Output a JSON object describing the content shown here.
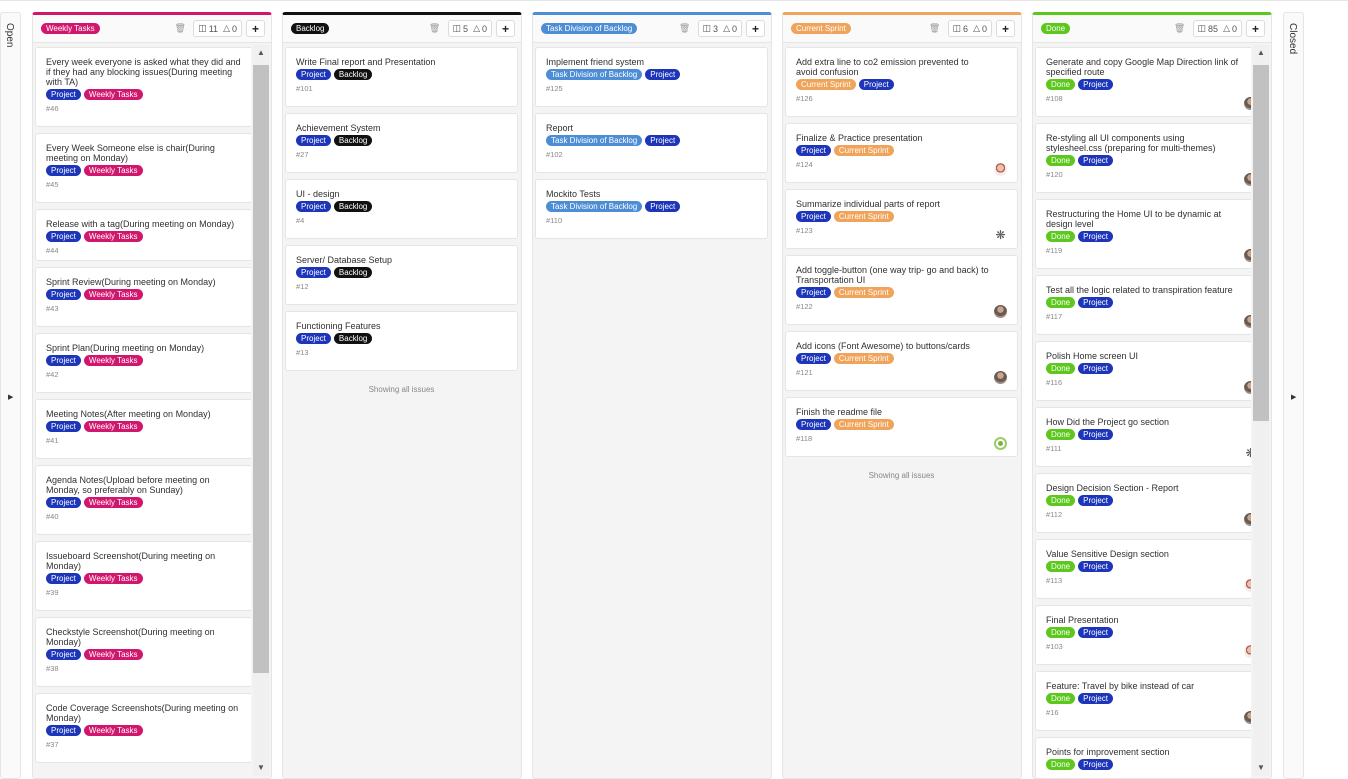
{
  "colors": {
    "weekly": "#d1176d",
    "backlog": "#111111",
    "task_division": "#4d8dd6",
    "current_sprint": "#f0a35a",
    "done": "#5cc71d",
    "project": "#1c35b9"
  },
  "sidebar_open": {
    "title": "Open",
    "arrow_icon": "triangle-right-icon"
  },
  "sidebar_closed": {
    "title": "Closed",
    "arrow_icon": "triangle-right-icon"
  },
  "lists": [
    {
      "label": "Weekly Tasks",
      "issues_count": "11",
      "weight": "0",
      "cards": [
        {
          "title": "Every week everyone is asked what they did and if they had any blocking issues(During meeting with TA)",
          "labels": [
            "Project",
            "Weekly Tasks"
          ],
          "number": "#46"
        },
        {
          "title": "Every Week Someone else is chair(During meeting on Monday)",
          "labels": [
            "Project",
            "Weekly Tasks"
          ],
          "number": "#45"
        },
        {
          "title": "Release with a tag(During meeting on Monday)",
          "labels": [
            "Project",
            "Weekly Tasks"
          ],
          "number": "#44"
        },
        {
          "title": "Sprint Review(During meeting on Monday)",
          "labels": [
            "Project",
            "Weekly Tasks"
          ],
          "number": "#43"
        },
        {
          "title": "Sprint Plan(During meeting on Monday)",
          "labels": [
            "Project",
            "Weekly Tasks"
          ],
          "number": "#42"
        },
        {
          "title": "Meeting Notes(After meeting on Monday)",
          "labels": [
            "Project",
            "Weekly Tasks"
          ],
          "number": "#41"
        },
        {
          "title": "Agenda Notes(Upload before meeting on Monday, so preferably on Sunday)",
          "labels": [
            "Project",
            "Weekly Tasks"
          ],
          "number": "#40"
        },
        {
          "title": "Issueboard Screenshot(During meeting on Monday)",
          "labels": [
            "Project",
            "Weekly Tasks"
          ],
          "number": "#39"
        },
        {
          "title": "Checkstyle Screenshot(During meeting on Monday)",
          "labels": [
            "Project",
            "Weekly Tasks"
          ],
          "number": "#38"
        },
        {
          "title": "Code Coverage Screenshots(During meeting on Monday)",
          "labels": [
            "Project",
            "Weekly Tasks"
          ],
          "number": "#37"
        }
      ]
    },
    {
      "label": "Backlog",
      "issues_count": "5",
      "weight": "0",
      "footer": "Showing all issues",
      "cards": [
        {
          "title": "Write Final report and Presentation",
          "labels": [
            "Project",
            "Backlog"
          ],
          "number": "#101"
        },
        {
          "title": "Achievement System",
          "labels": [
            "Project",
            "Backlog"
          ],
          "number": "#27"
        },
        {
          "title": "UI - design",
          "labels": [
            "Project",
            "Backlog"
          ],
          "number": "#4"
        },
        {
          "title": "Server/ Database Setup",
          "labels": [
            "Project",
            "Backlog"
          ],
          "number": "#12"
        },
        {
          "title": "Functioning Features",
          "labels": [
            "Project",
            "Backlog"
          ],
          "number": "#13"
        }
      ]
    },
    {
      "label": "Task Division of Backlog",
      "issues_count": "3",
      "weight": "0",
      "cards": [
        {
          "title": "Implement friend system",
          "labels": [
            "Task Division of Backlog",
            "Project"
          ],
          "number": "#125"
        },
        {
          "title": "Report",
          "labels": [
            "Task Division of Backlog",
            "Project"
          ],
          "number": "#102"
        },
        {
          "title": "Mockito Tests",
          "labels": [
            "Task Division of Backlog",
            "Project"
          ],
          "number": "#110"
        }
      ]
    },
    {
      "label": "Current Sprint",
      "issues_count": "6",
      "weight": "0",
      "footer": "Showing all issues",
      "cards": [
        {
          "title": "Add extra line to co2 emission prevented to avoid confusion",
          "labels": [
            "Current Sprint",
            "Project"
          ],
          "number": "#126"
        },
        {
          "title": "Finalize & Practice presentation",
          "labels": [
            "Project",
            "Current Sprint"
          ],
          "number": "#124",
          "avatar": "face"
        },
        {
          "title": "Summarize individual parts of report",
          "labels": [
            "Project",
            "Current Sprint"
          ],
          "number": "#123",
          "avatar": "gear"
        },
        {
          "title": "Add toggle-button (one way trip- go and back) to Transportation UI",
          "labels": [
            "Project",
            "Current Sprint"
          ],
          "number": "#122",
          "avatar": "photo"
        },
        {
          "title": "Add icons (Font Awesome) to buttons/cards",
          "labels": [
            "Project",
            "Current Sprint"
          ],
          "number": "#121",
          "avatar": "photo"
        },
        {
          "title": "Finish the readme file",
          "labels": [
            "Project",
            "Current Sprint"
          ],
          "number": "#118",
          "avatar": "ring"
        }
      ]
    },
    {
      "label": "Done",
      "issues_count": "85",
      "weight": "0",
      "cards": [
        {
          "title": "Generate and copy Google Map Direction link of specified route",
          "labels": [
            "Done",
            "Project"
          ],
          "number": "#108",
          "avatar": "photo"
        },
        {
          "title": "Re-styling all UI components using stylesheel.css (preparing for multi-themes)",
          "labels": [
            "Done",
            "Project"
          ],
          "number": "#120",
          "avatar": "photo"
        },
        {
          "title": "Restructuring the Home UI to be dynamic at design level",
          "labels": [
            "Done",
            "Project"
          ],
          "number": "#119",
          "avatar": "photo"
        },
        {
          "title": "Test all the logic related to transpiration feature",
          "labels": [
            "Done",
            "Project"
          ],
          "number": "#117",
          "avatar": "photo"
        },
        {
          "title": "Polish Home screen UI",
          "labels": [
            "Done",
            "Project"
          ],
          "number": "#116",
          "avatar": "photo"
        },
        {
          "title": "How Did the Project go section",
          "labels": [
            "Done",
            "Project"
          ],
          "number": "#111",
          "avatar": "gear"
        },
        {
          "title": "Design Decision Section - Report",
          "labels": [
            "Done",
            "Project"
          ],
          "number": "#112",
          "avatar": "photo"
        },
        {
          "title": "Value Sensitive Design section",
          "labels": [
            "Done",
            "Project"
          ],
          "number": "#113",
          "avatar": "face"
        },
        {
          "title": "Final Presentation",
          "labels": [
            "Done",
            "Project"
          ],
          "number": "#103",
          "avatar": "face"
        },
        {
          "title": "Feature: Travel by bike instead of car",
          "labels": [
            "Done",
            "Project"
          ],
          "number": "#16",
          "avatar": "photo"
        },
        {
          "title": "Points for improvement section",
          "labels": [
            "Done",
            "Project"
          ],
          "number": "",
          "avatar": ""
        }
      ]
    }
  ]
}
